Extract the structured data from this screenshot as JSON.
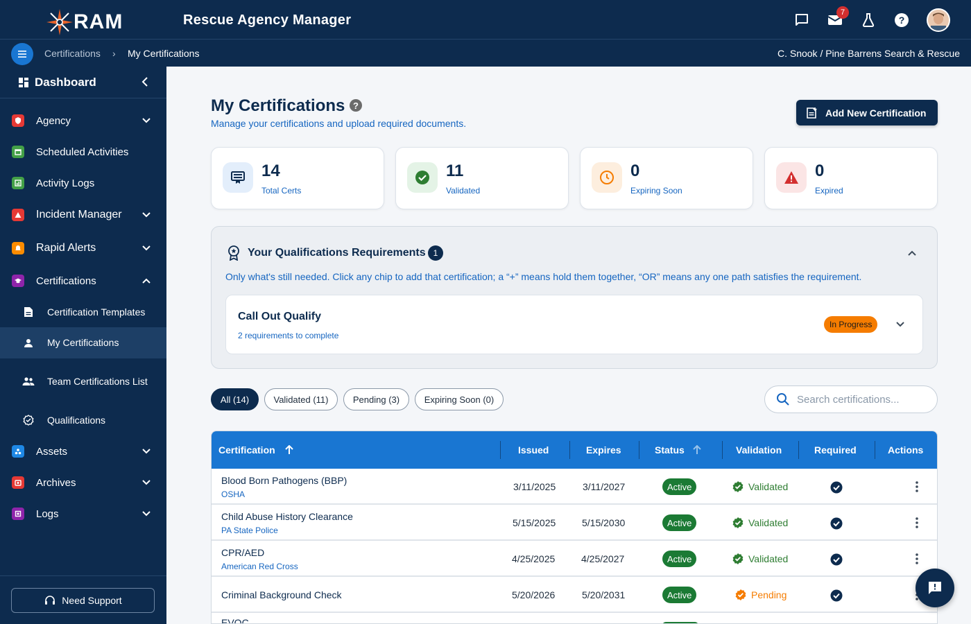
{
  "app": {
    "logo_text": "RAM",
    "title": "Rescue Agency Manager",
    "mail_badge": "7"
  },
  "breadcrumb": {
    "items": [
      "Certifications",
      "My Certifications"
    ],
    "separator": "›",
    "user_org": "C. Snook / Pine Barrens Search & Rescue"
  },
  "sidebar": {
    "dashboard": "Dashboard",
    "items": [
      {
        "label": "Agency",
        "icon": "shield-icon",
        "color": "#e53935"
      },
      {
        "label": "Scheduled Activities",
        "icon": "calendar-icon",
        "color": "#43a047"
      },
      {
        "label": "Activity Logs",
        "icon": "chart-icon",
        "color": "#43a047"
      },
      {
        "label": "Incident Manager",
        "icon": "warning-icon",
        "color": "#e53935"
      },
      {
        "label": "Rapid Alerts",
        "icon": "bell-icon",
        "color": "#fb8c00"
      },
      {
        "label": "Certifications",
        "icon": "graduation-cap-icon",
        "color": "#8e24aa"
      },
      {
        "label": "Assets",
        "icon": "assets-icon",
        "color": "#1e88e5"
      },
      {
        "label": "Archives",
        "icon": "archive-icon",
        "color": "#e53935"
      },
      {
        "label": "Logs",
        "icon": "logs-icon",
        "color": "#8e24aa"
      }
    ],
    "sub_items": [
      {
        "label": "Certification Templates",
        "icon": "document-icon"
      },
      {
        "label": "My Certifications",
        "icon": "person-icon"
      },
      {
        "label": "Team Certifications List",
        "icon": "group-icon"
      },
      {
        "label": "Qualifications",
        "icon": "badge-check-icon"
      }
    ],
    "support": "Need Support"
  },
  "page": {
    "title": "My Certifications",
    "subtitle": "Manage your certifications and upload required documents.",
    "add_button": "Add New Certification"
  },
  "stats": [
    {
      "value": "14",
      "label": "Total Certs",
      "icon": "certificate-icon",
      "bg": "#e3eefb",
      "color": "#0d2b4e"
    },
    {
      "value": "11",
      "label": "Validated",
      "icon": "check-circle-icon",
      "bg": "#e4f3e6",
      "color": "#2e7d32"
    },
    {
      "value": "0",
      "label": "Expiring Soon",
      "icon": "clock-icon",
      "bg": "#fdeede",
      "color": "#f57c00"
    },
    {
      "value": "0",
      "label": "Expired",
      "icon": "alert-icon",
      "bg": "#fbe5e5",
      "color": "#d32f2f"
    }
  ],
  "qualifications": {
    "title": "Your Qualifications Requirements",
    "count": "1",
    "description": "Only what's still needed. Click any chip to add that certification; a “+” means hold them together, “OR” means any one path satisfies the requirement.",
    "card": {
      "title": "Call Out Qualify",
      "subtitle": "2 requirements to complete",
      "status": "In Progress"
    }
  },
  "filters": [
    {
      "label": "All (14)",
      "active": true
    },
    {
      "label": "Validated (11)",
      "active": false
    },
    {
      "label": "Pending (3)",
      "active": false
    },
    {
      "label": "Expiring Soon (0)",
      "active": false
    }
  ],
  "search": {
    "placeholder": "Search certifications..."
  },
  "table": {
    "headers": [
      "Certification",
      "Issued",
      "Expires",
      "Status",
      "Validation",
      "Required",
      "Actions"
    ],
    "rows": [
      {
        "name": "Blood Born Pathogens (BBP)",
        "org": "OSHA",
        "issued": "3/11/2025",
        "expires": "3/11/2027",
        "status": "Active",
        "validation": "Validated",
        "required": true
      },
      {
        "name": "Child Abuse History Clearance",
        "org": "PA State Police",
        "issued": "5/15/2025",
        "expires": "5/15/2030",
        "status": "Active",
        "validation": "Validated",
        "required": true
      },
      {
        "name": "CPR/AED",
        "org": "American Red Cross",
        "issued": "4/25/2025",
        "expires": "4/25/2027",
        "status": "Active",
        "validation": "Validated",
        "required": true
      },
      {
        "name": "Criminal Background Check",
        "org": "",
        "issued": "5/20/2026",
        "expires": "5/20/2031",
        "status": "Active",
        "validation": "Pending",
        "required": true
      },
      {
        "name": "EVOC",
        "org": "",
        "issued": "",
        "expires": "",
        "status": "",
        "validation": "",
        "required": false
      }
    ]
  },
  "colors": {
    "navy": "#0d2b4e",
    "blue": "#1976d2",
    "active_green": "#1b7a34",
    "validated_green": "#2e7d32",
    "pending_orange": "#f57c00"
  }
}
